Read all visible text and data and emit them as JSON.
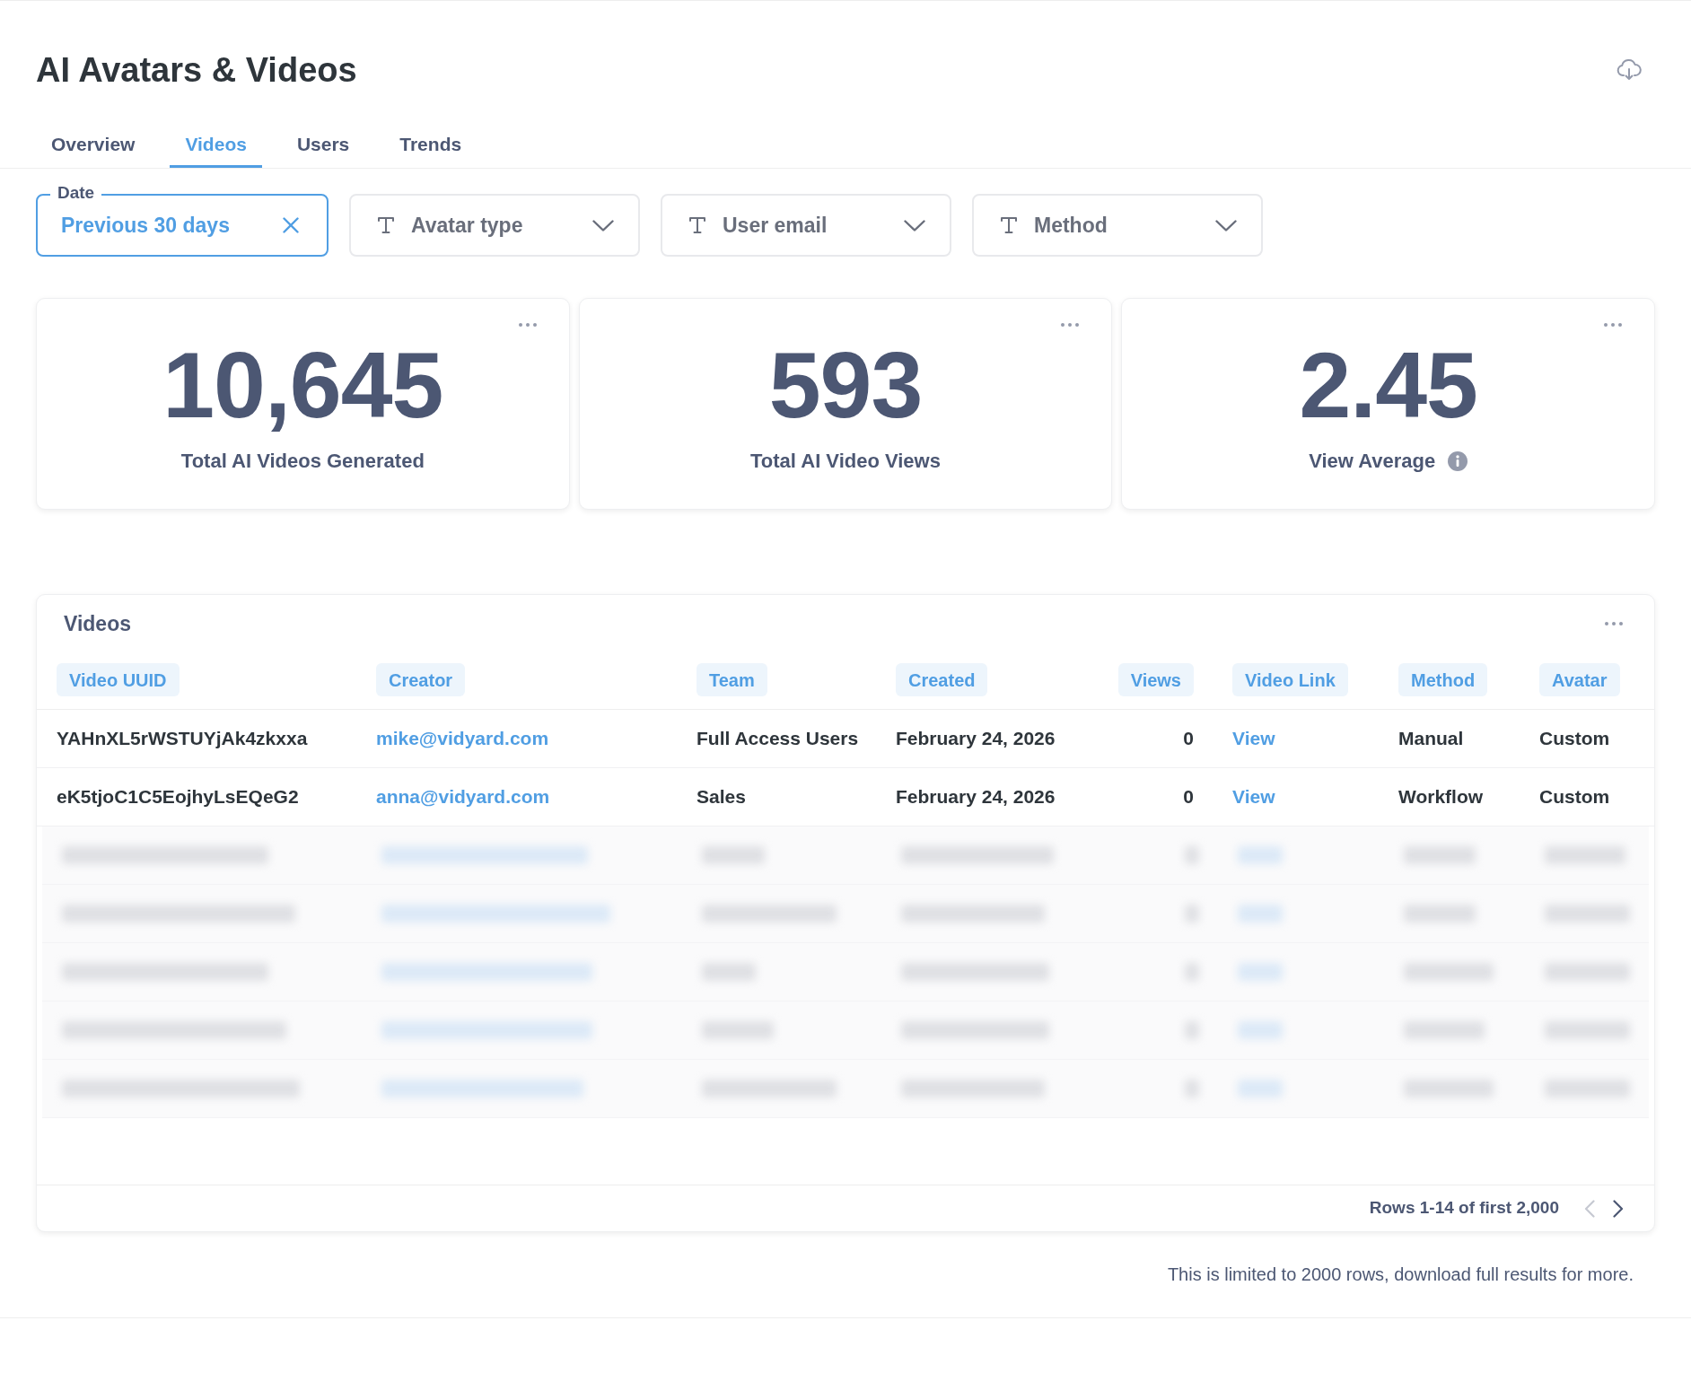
{
  "page": {
    "title": "AI Avatars & Videos"
  },
  "tabs": [
    {
      "label": "Overview",
      "selected": false
    },
    {
      "label": "Videos",
      "selected": true
    },
    {
      "label": "Users",
      "selected": false
    },
    {
      "label": "Trends",
      "selected": false
    }
  ],
  "filters": [
    {
      "kind": "date",
      "label": "Date",
      "value": "Previous 30 days"
    },
    {
      "kind": "text",
      "label": "Avatar type"
    },
    {
      "kind": "text",
      "label": "User email"
    },
    {
      "kind": "text",
      "label": "Method"
    }
  ],
  "stats": [
    {
      "value": "10,645",
      "label": "Total AI Videos Generated",
      "info": false
    },
    {
      "value": "593",
      "label": "Total AI Video Views",
      "info": false
    },
    {
      "value": "2.45",
      "label": "View Average",
      "info": true
    }
  ],
  "table": {
    "title": "Videos",
    "columns": [
      {
        "label": "Video UUID",
        "kind": "text"
      },
      {
        "label": "Creator",
        "kind": "email"
      },
      {
        "label": "Team",
        "kind": "text"
      },
      {
        "label": "Created",
        "kind": "text"
      },
      {
        "label": "Views",
        "kind": "number"
      },
      {
        "label": "Video Link",
        "kind": "link"
      },
      {
        "label": "Method",
        "kind": "text"
      },
      {
        "label": "Avatar",
        "kind": "text"
      }
    ],
    "rows": [
      {
        "kind": "data",
        "cells": [
          "YAHnXL5rWSTUYjAk4zkxxa",
          "mike@vidyard.com",
          "Full Access Users",
          "February 24, 2026",
          "0",
          "View",
          "Manual",
          "Custom"
        ]
      },
      {
        "kind": "data",
        "cells": [
          "eK5tjoC1C5EojhyLsEQeG2",
          "anna@vidyard.com",
          "Sales",
          "February 24, 2026",
          "0",
          "View",
          "Workflow",
          "Custom"
        ]
      },
      {
        "kind": "blurred"
      },
      {
        "kind": "blurred"
      },
      {
        "kind": "blurred"
      },
      {
        "kind": "blurred"
      },
      {
        "kind": "blurred"
      }
    ],
    "pagination": {
      "text": "Rows 1-14 of first 2,000",
      "previous": {
        "disabled": true
      },
      "next": {
        "disabled": false
      }
    }
  },
  "note": "This is limited to 2000 rows, download full results for more."
}
